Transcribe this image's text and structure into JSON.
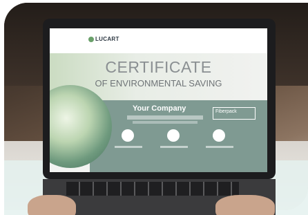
{
  "certificate": {
    "brand": "LUCART",
    "title": "CERTIFICATE",
    "subtitle": "OF ENVIRONMENTAL SAVING",
    "company": "Your Company",
    "badge": "Fiberpack"
  }
}
